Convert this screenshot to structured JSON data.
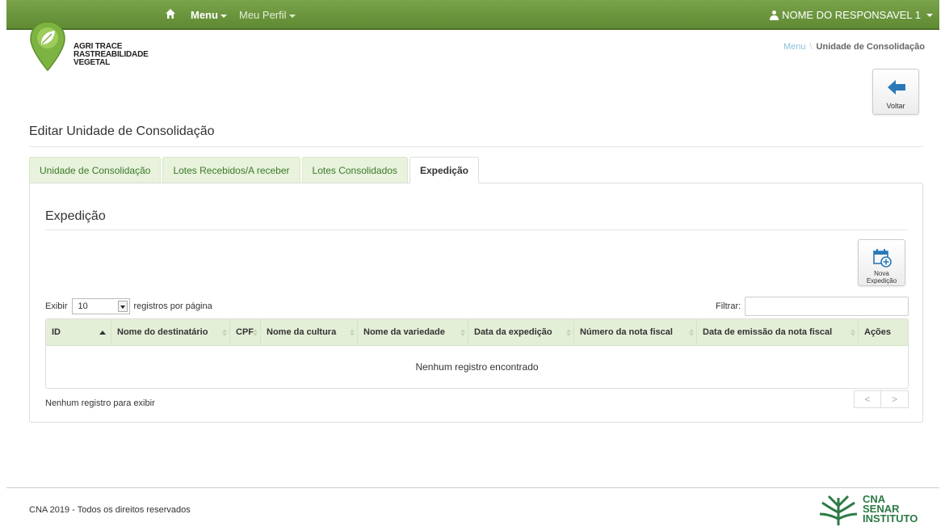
{
  "navbar": {
    "menu_label": "Menu",
    "perfil_label": "Meu Perfil",
    "user_label": "NOME DO RESPONSAVEL 1"
  },
  "logo": {
    "line1": "AGRI TRACE",
    "line2": "RASTREABILIDADE",
    "line3": "VEGETAL"
  },
  "breadcrumb": {
    "link": "Menu",
    "current": "Unidade de Consolidação"
  },
  "voltar_label": "Voltar",
  "page_title": "Editar Unidade de Consolidação",
  "tabs": [
    {
      "label": "Unidade de Consolidação",
      "active": false
    },
    {
      "label": "Lotes Recebidos/A receber",
      "active": false
    },
    {
      "label": "Lotes Consolidados",
      "active": false
    },
    {
      "label": "Expedição",
      "active": true
    }
  ],
  "section_title": "Expedição",
  "nova_label_line1": "Nova",
  "nova_label_line2": "Expedição",
  "controls": {
    "exibir_label": "Exibir",
    "page_size": "10",
    "registros_label": "registros por página",
    "filtrar_label": "Filtrar:",
    "filter_value": ""
  },
  "table": {
    "columns": [
      "ID",
      "Nome do destinatário",
      "CPF",
      "Nome da cultura",
      "Nome da variedade",
      "Data da expedição",
      "Número da nota fiscal",
      "Data de emissão da nota fiscal",
      "Ações"
    ],
    "empty_message": "Nenhum registro encontrado",
    "info": "Nenhum registro para exibir",
    "prev": "<",
    "next": ">"
  },
  "footer": {
    "copyright": "CNA 2019 - Todos os direitos reservados",
    "logo_line1": "CNA",
    "logo_line2": "SENAR",
    "logo_line3": "INSTITUTO"
  },
  "colors": {
    "navbar": "#6a9440",
    "tab_bg": "#e8f2dc",
    "header_bg": "#e4efd8",
    "logo_green": "#7cb342",
    "footer_green": "#2c7a45"
  }
}
